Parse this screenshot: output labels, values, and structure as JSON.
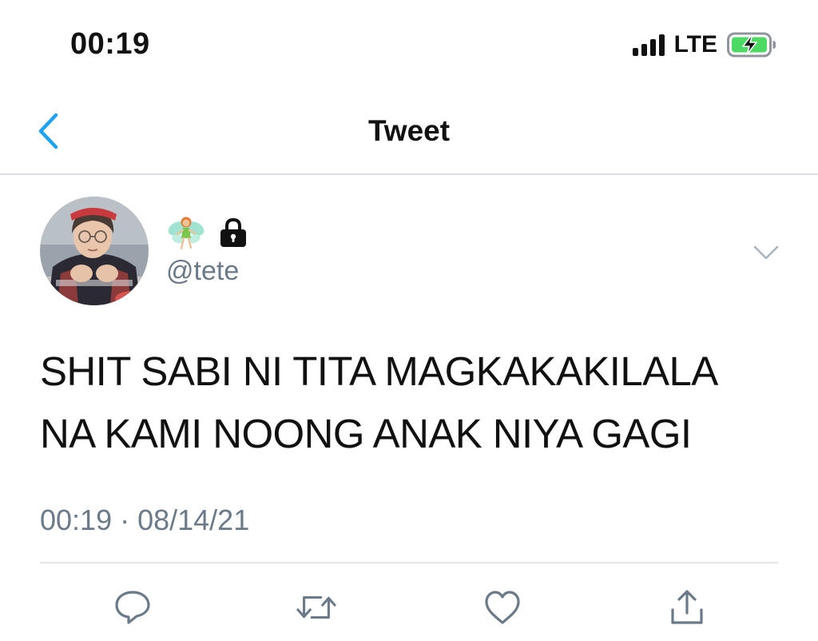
{
  "status_bar": {
    "time": "00:19",
    "network": "LTE",
    "icons": [
      "signal-bars-icon",
      "battery-charging-icon"
    ]
  },
  "nav": {
    "title": "Tweet",
    "back_icon": "chevron-left-icon"
  },
  "author": {
    "handle": "@tete",
    "avatar": "avatar",
    "name_icons": [
      "fairy-emoji-icon",
      "lock-icon"
    ]
  },
  "tweet": {
    "text": "SHIT SABI NI TITA MAGKAKAKILALA NA KAMI NOONG ANAK NIYA GAGI",
    "timestamp": "00:19 · 08/14/21"
  },
  "actions": [
    "reply-icon",
    "retweet-icon",
    "like-icon",
    "share-icon"
  ],
  "colors": {
    "accent": "#1da1f2",
    "secondary_text": "#6b7a89",
    "battery_green": "#4cd964",
    "divider": "#dcdfe3"
  }
}
